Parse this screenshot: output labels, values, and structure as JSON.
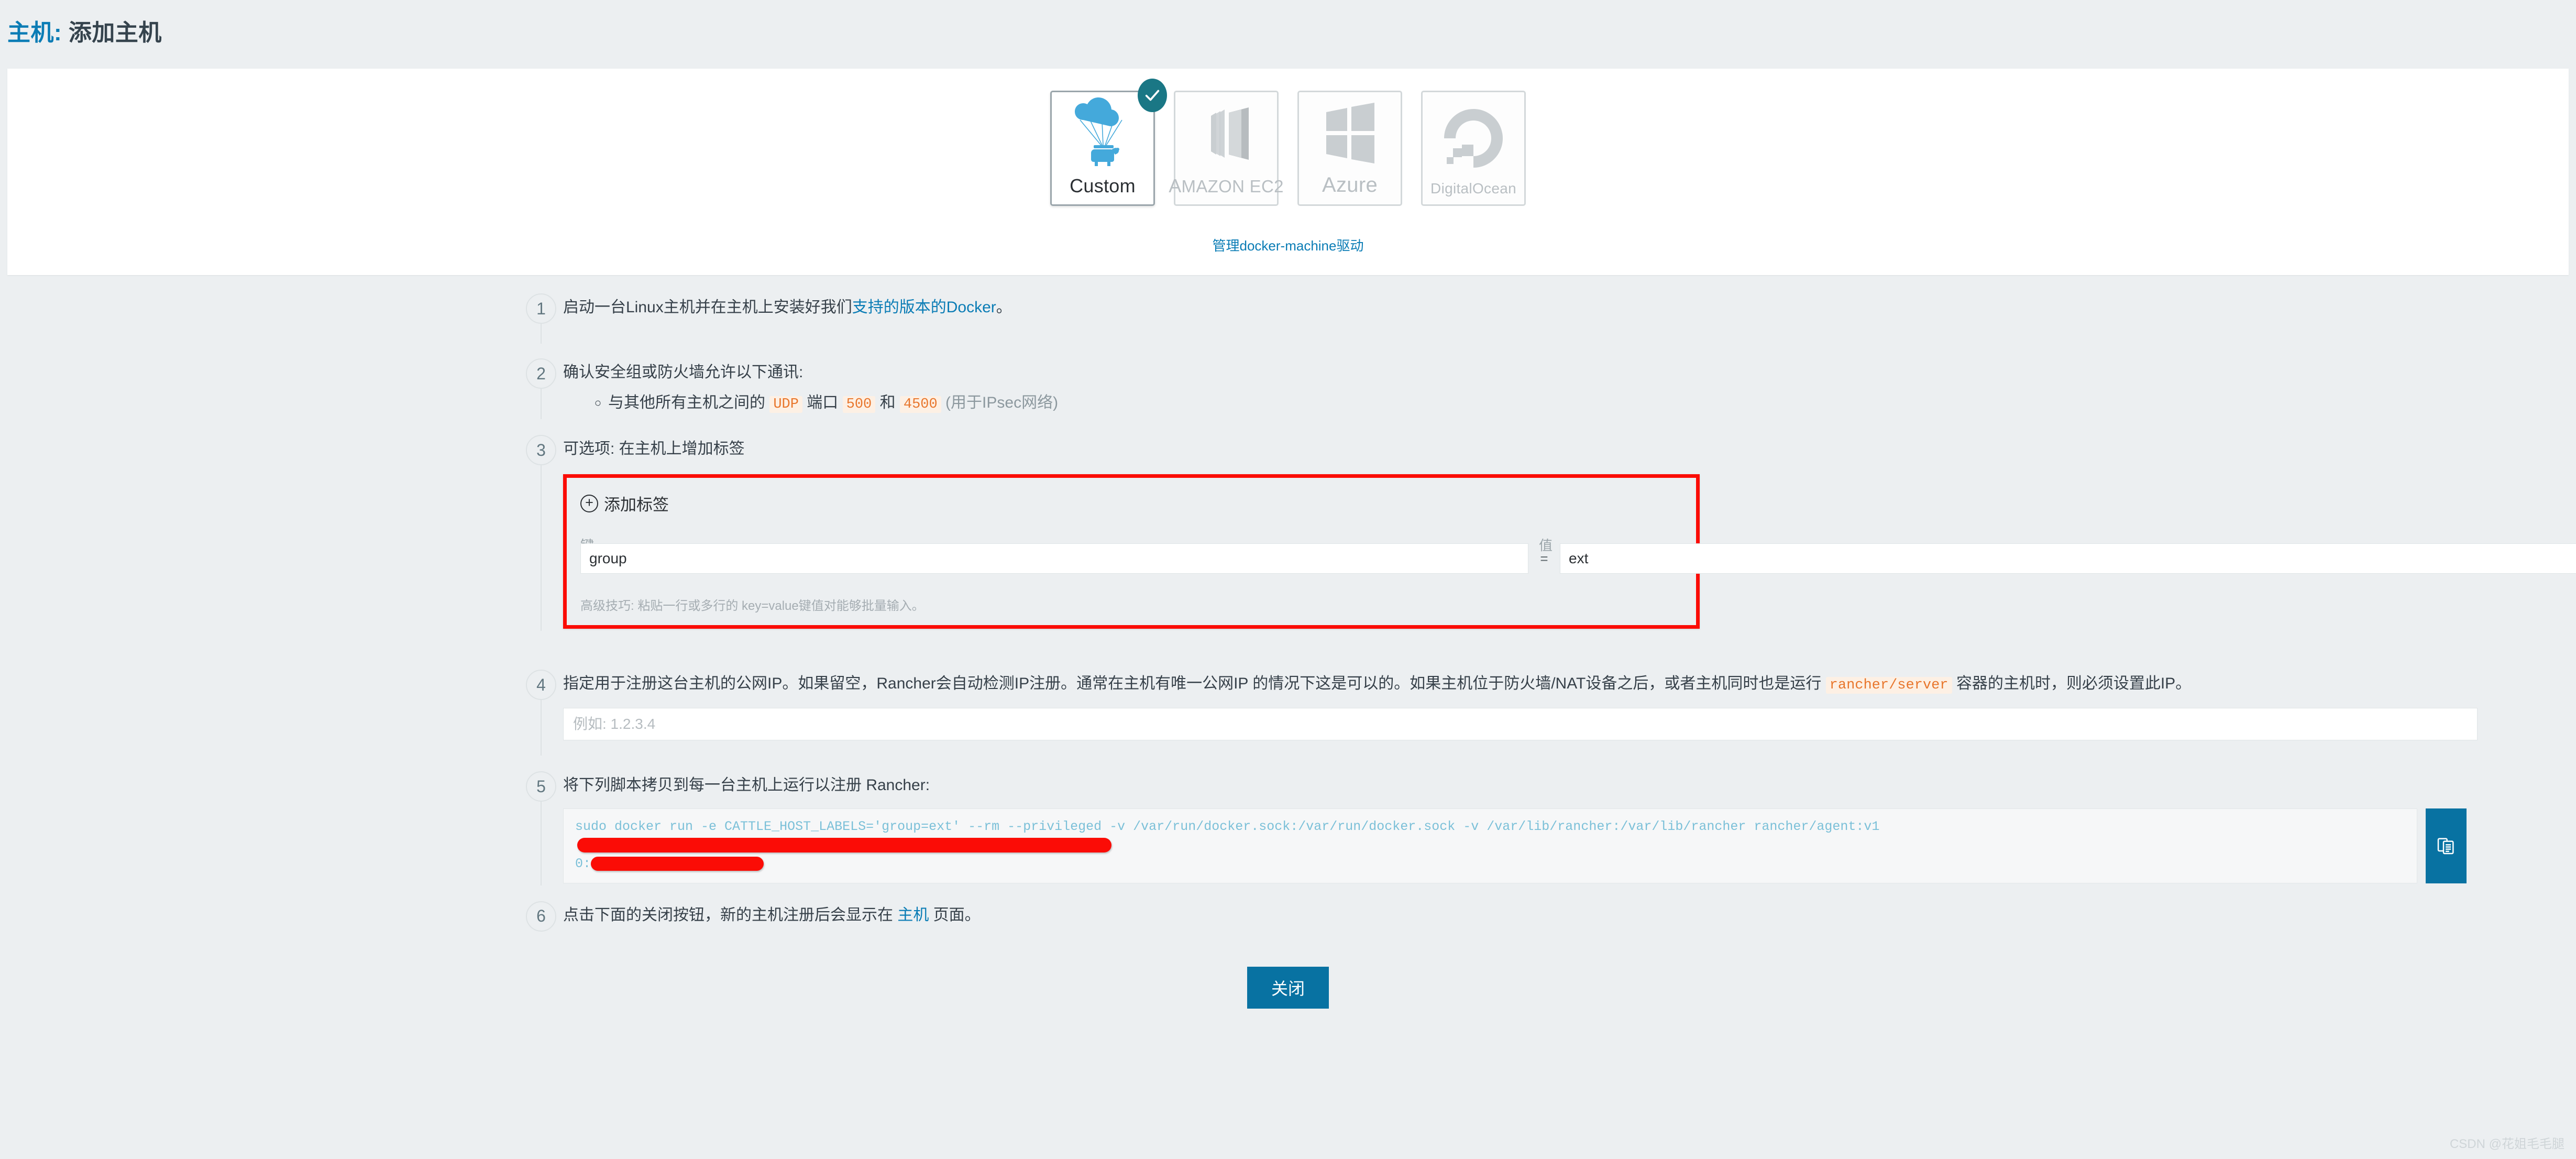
{
  "header": {
    "title_prefix": "主机:",
    "title_rest": " 添加主机"
  },
  "drivers": {
    "manage_link": "管理docker-machine驱动",
    "items": [
      {
        "id": "custom",
        "label": "Custom",
        "icon": "cloud-parachute-cow-icon",
        "selected": true
      },
      {
        "id": "amazon-ec2",
        "label_small": "A",
        "label": "MAZON EC2",
        "icon": "aws-ec2-icon",
        "selected": false
      },
      {
        "id": "azure",
        "label": "Azure",
        "icon": "azure-windows-icon",
        "selected": false
      },
      {
        "id": "digitalocean",
        "label": "DigitalOcean",
        "icon": "digitalocean-icon",
        "selected": false
      }
    ]
  },
  "steps": {
    "s1": {
      "num": "1",
      "a": "启动一台Linux主机并在主机上安装好我们",
      "link": "支持的版本的Docker",
      "b": "。"
    },
    "s2": {
      "num": "2",
      "title": "确认安全组或防火墙允许以下通讯:",
      "bullet_a": "与其他所有主机之间的 ",
      "code_udp": "UDP",
      "bullet_b": " 端口 ",
      "code_500": "500",
      "bullet_c": " 和 ",
      "code_4500": "4500",
      "bullet_d": " (用于IPsec网络)"
    },
    "s3": {
      "num": "3",
      "title": "可选项: 在主机上增加标签",
      "add_label": "添加标签",
      "key_label": "键",
      "value_label": "值",
      "equals": "=",
      "key_value": "group",
      "value_value": "ext",
      "hint": "高级技巧: 粘贴一行或多行的 key=value键值对能够批量输入。",
      "remove_icon": "minus-icon"
    },
    "s4": {
      "num": "4",
      "a": "指定用于注册这台主机的公网IP。如果留空，Rancher会自动检测IP注册。通常在主机有唯一公网IP 的情况下这是可以的。如果主机位于防火墙/NAT设备之后，或者主机同时也是运行 ",
      "code": "rancher/server",
      "b": " 容器的主机时，则必须设置此IP。",
      "ip_placeholder": "例如: 1.2.3.4",
      "ip_value": ""
    },
    "s5": {
      "num": "5",
      "title": "将下列脚本拷贝到每一台主机上运行以注册 Rancher:",
      "script_line1": "sudo docker run -e CATTLE_HOST_LABELS='group=ext'  --rm --privileged -v /var/run/docker.sock:/var/run/docker.sock -v /var/lib/rancher:/var/lib/rancher rancher/agent:v1",
      "script_line2_prefix": "0:",
      "copy_icon": "clipboard-copy-icon"
    },
    "s6": {
      "num": "6",
      "a": "点击下面的关闭按钮，新的主机注册后会显示在 ",
      "link": "主机",
      "b": " 页面。"
    }
  },
  "footer": {
    "close_label": "关闭",
    "watermark": "CSDN @花姐毛毛腿"
  },
  "colors": {
    "accent_blue": "#0872a2",
    "link_blue": "#0a7cb5",
    "check_teal": "#1a7785",
    "highlight_red": "#fb0c06",
    "code_orange": "#e8762c",
    "page_bg": "#eceff1"
  }
}
